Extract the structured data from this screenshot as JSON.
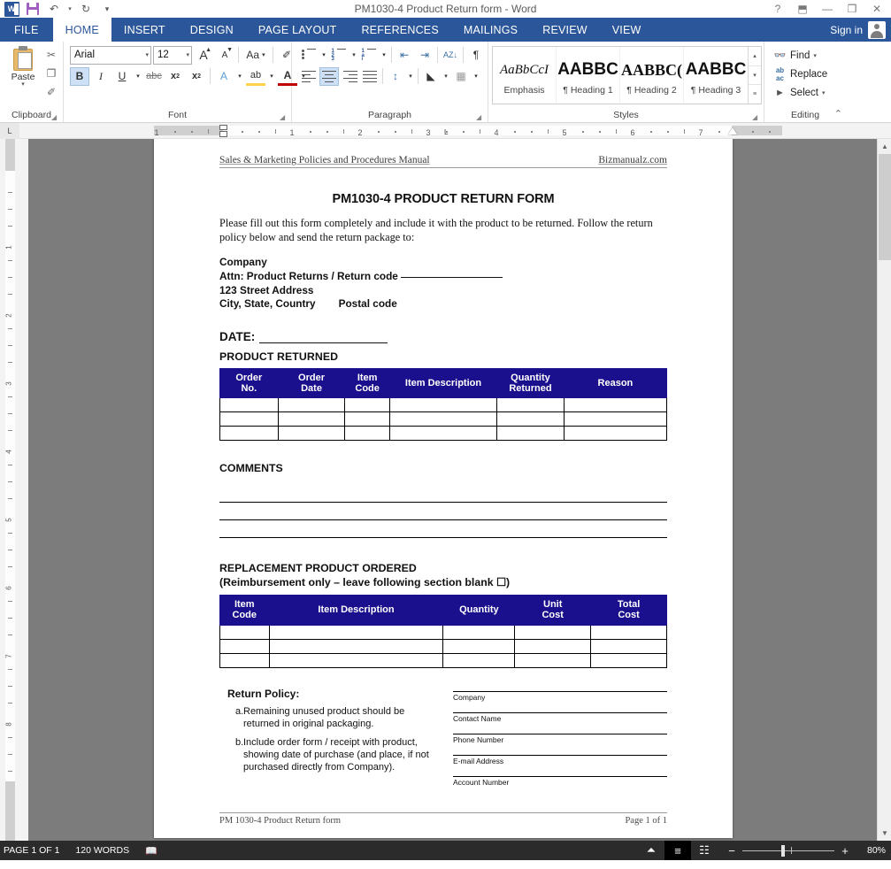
{
  "titlebar": {
    "document_title": "PM1030-4 Product Return form - Word",
    "quick_access": [
      {
        "name": "word-logo",
        "label": "W"
      },
      {
        "name": "save",
        "label": "save-icon"
      },
      {
        "name": "undo",
        "label": "↶"
      },
      {
        "name": "undo-dropdown",
        "label": "▾"
      },
      {
        "name": "redo",
        "label": "↻"
      },
      {
        "name": "customize-qat",
        "label": "☰"
      }
    ],
    "window_controls": [
      {
        "name": "help",
        "label": "?"
      },
      {
        "name": "ribbon-display-options",
        "label": "⬒"
      },
      {
        "name": "minimize",
        "label": "—"
      },
      {
        "name": "restore",
        "label": "❐"
      },
      {
        "name": "close",
        "label": "✕"
      }
    ]
  },
  "tabs": {
    "file_label": "FILE",
    "items": [
      {
        "label": "HOME",
        "active": true
      },
      {
        "label": "INSERT",
        "active": false
      },
      {
        "label": "DESIGN",
        "active": false
      },
      {
        "label": "PAGE LAYOUT",
        "active": false
      },
      {
        "label": "REFERENCES",
        "active": false
      },
      {
        "label": "MAILINGS",
        "active": false
      },
      {
        "label": "REVIEW",
        "active": false
      },
      {
        "label": "VIEW",
        "active": false
      }
    ],
    "sign_in": "Sign in"
  },
  "ribbon": {
    "clipboard": {
      "group_label": "Clipboard",
      "paste_label": "Paste",
      "paste_caret": "▾",
      "cut_icon": "✂",
      "copy_icon": "❐",
      "format_painter_icon": "✐"
    },
    "font": {
      "group_label": "Font",
      "font_name": "Arial",
      "font_size": "12",
      "caret": "▾",
      "grow_font": "A",
      "shrink_font": "A",
      "change_case": "Aa",
      "clear_formatting": "✐",
      "bold": "B",
      "italic": "I",
      "underline": "U",
      "strikethrough": "abc",
      "subscript": "x",
      "subscript_sup": "2",
      "superscript": "x",
      "superscript_sup": "2",
      "text_effects": "A",
      "text_highlight": "ab",
      "font_color": "A"
    },
    "paragraph": {
      "group_label": "Paragraph",
      "bullets": "bullet-list-icon",
      "numbering": "numbered-list-icon",
      "multilevel": "multilevel-list-icon",
      "decrease_indent": "⇤",
      "increase_indent": "⇥",
      "sort": "AZ↓",
      "show_marks": "¶",
      "align_left": "align-left-icon",
      "align_center": "align-center-icon",
      "align_right": "align-right-icon",
      "justify": "justify-icon",
      "line_spacing": "↕",
      "shading": "shading-icon",
      "borders": "borders-icon"
    },
    "styles": {
      "group_label": "Styles",
      "items": [
        {
          "preview": "AaBbCcI",
          "name": "Emphasis",
          "pilcrow": ""
        },
        {
          "preview": "AABBC",
          "name": "Heading 1",
          "pilcrow": "¶ "
        },
        {
          "preview": "AABBC(",
          "name": "Heading 2",
          "pilcrow": "¶ "
        },
        {
          "preview": "AABBC",
          "name": "Heading 3",
          "pilcrow": "¶ "
        }
      ],
      "scroll_up": "▴",
      "scroll_down": "▾",
      "more": "≡"
    },
    "editing": {
      "group_label": "Editing",
      "find": "Find",
      "find_caret": "▾",
      "replace": "Replace",
      "select": "Select",
      "select_caret": "▾"
    },
    "collapse_icon": "⌃"
  },
  "ruler": {
    "h_ticks": [
      "1",
      "1",
      "2",
      "3",
      "4",
      "5",
      "6",
      "7"
    ],
    "v_ticks": [
      "1",
      "2",
      "3",
      "4",
      "5",
      "6",
      "7",
      "8"
    ],
    "tab_stop": "L"
  },
  "document": {
    "header_left": "Sales & Marketing Policies and Procedures Manual",
    "header_right": "Bizmanualz.com",
    "title": "PM1030-4 PRODUCT RETURN FORM",
    "intro": "Please fill out this form completely and include it with the product to be returned.  Follow the return policy below and send the return package to:",
    "address": {
      "line1": "Company",
      "line2_a": "Attn: Product Returns / Return code",
      "line3": "123 Street Address",
      "line4_a": "City, State, Country",
      "line4_b": "Postal code"
    },
    "date_label": "DATE:",
    "product_returned_label": "PRODUCT RETURNED",
    "product_returned_table": {
      "headers": [
        "Order No.",
        "Order Date",
        "Item Code",
        "Item Description",
        "Quantity Returned",
        "Reason"
      ],
      "rows": [
        [
          "",
          "",
          "",
          "",
          "",
          ""
        ],
        [
          "",
          "",
          "",
          "",
          "",
          ""
        ],
        [
          "",
          "",
          "",
          "",
          "",
          ""
        ]
      ]
    },
    "comments_label": "COMMENTS",
    "comment_lines": [
      "",
      "",
      ""
    ],
    "replacement_label_line1": "REPLACEMENT PRODUCT ORDERED",
    "replacement_label_line2": "(Reimbursement only – leave following section blank ☐)",
    "replacement_table": {
      "headers": [
        "Item Code",
        "Item Description",
        "Quantity",
        "Unit Cost",
        "Total Cost"
      ],
      "rows": [
        [
          "",
          "",
          "",
          "",
          ""
        ],
        [
          "",
          "",
          "",
          "",
          ""
        ],
        [
          "",
          "",
          "",
          "",
          ""
        ]
      ]
    },
    "policy_title": "Return Policy:",
    "policy_items": [
      {
        "marker": "a.",
        "text": "Remaining unused product should be returned in original packaging."
      },
      {
        "marker": "b.",
        "text": "Include order form / receipt with product, showing date of purchase (and place, if not purchased directly from Company)."
      }
    ],
    "signature_fields": [
      "Company",
      "Contact Name",
      "Phone Number",
      "E-mail Address",
      "Account Number"
    ],
    "footer_left": "PM 1030-4 Product Return form",
    "footer_right": "Page 1 of 1"
  },
  "statusbar": {
    "page_status": "PAGE 1 OF 1",
    "word_count": "120 WORDS",
    "proofing_icon": "proofing-errors-icon",
    "views": [
      {
        "name": "read-mode",
        "icon": "⏶",
        "selected": false
      },
      {
        "name": "print-layout",
        "icon": "≡",
        "selected": true
      },
      {
        "name": "web-layout",
        "icon": "☷",
        "selected": false
      }
    ],
    "zoom_out": "−",
    "zoom_in": "+",
    "zoom_level": "80%"
  },
  "colors": {
    "word_blue": "#2b579a",
    "table_header": "#1a0f8c",
    "statusbar": "#2b2b2b",
    "canvas": "#7c7c7c"
  }
}
